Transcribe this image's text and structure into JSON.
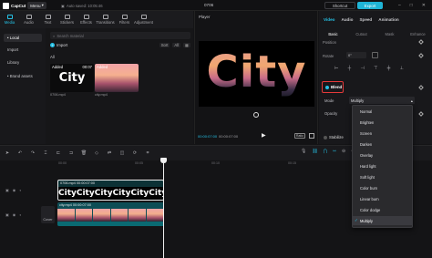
{
  "titlebar": {
    "app_name": "CapCut",
    "menu_label": "Menu",
    "autosave": "Auto saved: 10:05:46",
    "project_title": "0706",
    "shortcut_label": "Shortcut",
    "export_label": "Export"
  },
  "media_tabs": [
    {
      "label": "Media",
      "icon": "media-icon",
      "active": true
    },
    {
      "label": "Audio",
      "icon": "audio-icon",
      "active": false
    },
    {
      "label": "Text",
      "icon": "text-icon",
      "active": false
    },
    {
      "label": "Stickers",
      "icon": "stickers-icon",
      "active": false
    },
    {
      "label": "Effects",
      "icon": "effects-icon",
      "active": false
    },
    {
      "label": "Transitions",
      "icon": "transitions-icon",
      "active": false
    },
    {
      "label": "Filters",
      "icon": "filters-icon",
      "active": false
    },
    {
      "label": "Adjustment",
      "icon": "adjustment-icon",
      "active": false
    }
  ],
  "sidebar": {
    "items": [
      {
        "label": "• Local",
        "active": true
      },
      {
        "label": "Import",
        "active": false
      },
      {
        "label": "Library",
        "active": false
      },
      {
        "label": "• Brand assets",
        "active": false
      }
    ]
  },
  "media": {
    "search_placeholder": "Search material",
    "import_label": "Import",
    "sort_label": "Sort",
    "filter_label": "All",
    "all_label": "All",
    "clips": [
      {
        "added": "Added",
        "duration": "00:07",
        "thumb_text": "City",
        "name": "0706.mp4"
      },
      {
        "added": "Added",
        "duration": "",
        "thumb_text": "",
        "name": "city.mp4"
      }
    ]
  },
  "player": {
    "label": "Player",
    "preview_text": "City",
    "time_current": "00:00:07:00",
    "time_total": "00:00:07:00",
    "ratio_label": "Ratio"
  },
  "right_panel": {
    "tabs": [
      {
        "label": "Video",
        "active": true
      },
      {
        "label": "Audio",
        "active": false
      },
      {
        "label": "Speed",
        "active": false
      },
      {
        "label": "Animation",
        "active": false
      }
    ],
    "subtabs": [
      {
        "label": "Basic",
        "active": true
      },
      {
        "label": "Cutout",
        "active": false
      },
      {
        "label": "Mask",
        "active": false
      },
      {
        "label": "Enhance",
        "active": false
      }
    ],
    "position_label": "Position",
    "rotate_label": "Rotate",
    "rotate_value": "0°",
    "blend_label": "Blend",
    "mode_label": "Mode",
    "mode_value": "Multiply",
    "opacity_label": "Opacity",
    "stabilize_label": "Stabilize"
  },
  "blend_modes": {
    "options": [
      "Normal",
      "Brighten",
      "Screen",
      "Darken",
      "Overlay",
      "Hard light",
      "Soft light",
      "Color burn",
      "Linear burn",
      "Color dodge",
      "Multiply"
    ],
    "selected": "Multiply"
  },
  "timeline": {
    "ruler_ticks": [
      "00:00",
      "00:05",
      "00:10",
      "00:15",
      "00:20"
    ],
    "text_clip_label": "0706.mp4  00:00:07:00",
    "text_clip_frame_text": "City",
    "city_clip_label": "city.mp4  00:00:07:00",
    "cover_label": "Cover"
  },
  "colors": {
    "accent": "#26c2e6",
    "highlight_border": "#e53a3a",
    "text_clip_bg": "#0c3236",
    "video_clip_bg": "#0d4d55"
  }
}
